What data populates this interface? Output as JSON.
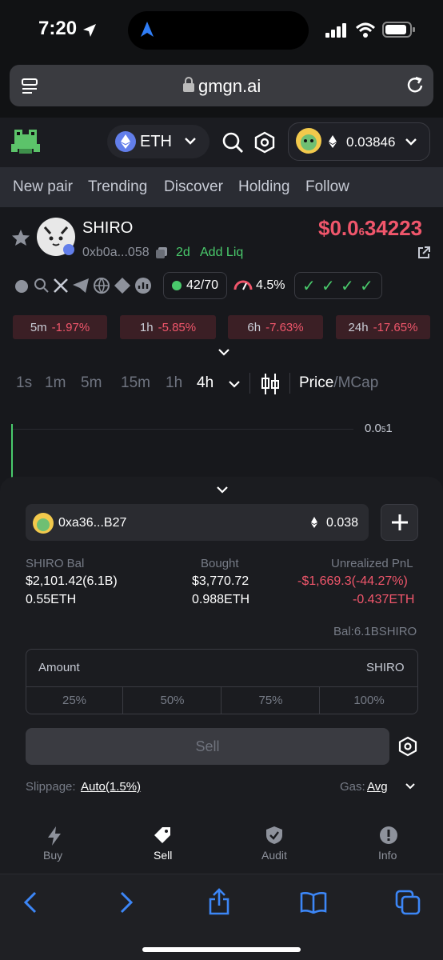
{
  "status": {
    "time": "7:20"
  },
  "browser": {
    "url": "gmgn.ai"
  },
  "header": {
    "chain": "ETH",
    "wallet_balance": "0.03846"
  },
  "nav": {
    "items": [
      "New pair",
      "Trending",
      "Discover",
      "Holding",
      "Follow"
    ]
  },
  "token": {
    "name": "SHIRO",
    "address": "0xb0a...058",
    "age": "2d",
    "add_liq": "Add Liq",
    "price_prefix": "$0.0",
    "price_sub": "6",
    "price_suffix": "34223",
    "holders": "42/70",
    "tax": "4.5%",
    "checks": [
      "✓",
      "✓",
      "✓",
      "✓"
    ]
  },
  "changes": [
    {
      "label": "5m",
      "value": "-1.97%"
    },
    {
      "label": "1h",
      "value": "-5.85%"
    },
    {
      "label": "6h",
      "value": "-7.63%"
    },
    {
      "label": "24h",
      "value": "-17.65%"
    }
  ],
  "timeframes": [
    "1s",
    "1m",
    "5m",
    "15m",
    "1h",
    "4h"
  ],
  "chart_toggle": {
    "price": "Price",
    "sep": "/",
    "mcap": "MCap"
  },
  "chart": {
    "axis_prefix": "0.0",
    "axis_sub": "5",
    "axis_suffix": "1"
  },
  "trade": {
    "wallet": "0xa36...B27",
    "wallet_eth": "0.038",
    "bal_label": "SHIRO Bal",
    "bal_usd": "$2,101.42(6.1B)",
    "bal_eth": "0.55ETH",
    "bought_label": "Bought",
    "bought_usd": "$3,770.72",
    "bought_eth": "0.988ETH",
    "pnl_label": "Unrealized PnL",
    "pnl_usd": "-$1,669.3(-44.27%)",
    "pnl_eth": "-0.437ETH",
    "bal_right": "Bal:6.1BSHIRO",
    "amount_label": "Amount",
    "amount_unit": "SHIRO",
    "percents": [
      "25%",
      "50%",
      "75%",
      "100%"
    ],
    "sell": "Sell",
    "slippage_label": "Slippage:",
    "slippage_value": "Auto(1.5%)",
    "gas_label": "Gas:",
    "gas_value": "Avg"
  },
  "tabs": [
    {
      "label": "Buy",
      "icon": "bolt-icon"
    },
    {
      "label": "Sell",
      "icon": "tag-icon"
    },
    {
      "label": "Audit",
      "icon": "shield-icon"
    },
    {
      "label": "Info",
      "icon": "info-icon"
    }
  ],
  "colors": {
    "accent": "#f0566b",
    "link": "#3c86f6",
    "green": "#49c96b"
  }
}
